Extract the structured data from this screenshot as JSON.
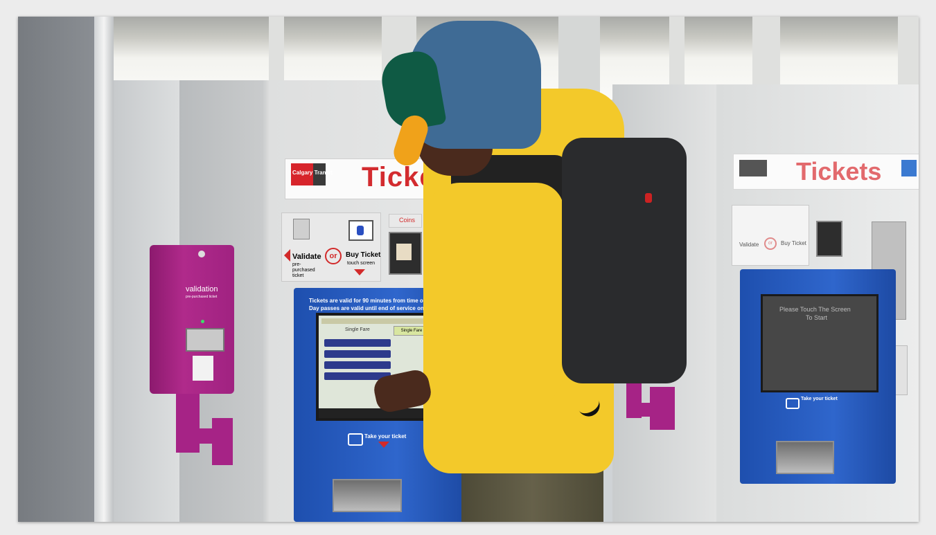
{
  "scene": {
    "left_kiosk": {
      "header": "Tickets",
      "logo": "Calgary Transit",
      "validate_label": "Validate",
      "validate_sub": "pre-purchased ticket",
      "or_label": "or",
      "buy_label": "Buy Ticket",
      "buy_sub": "touch screen",
      "coins_label": "Coins",
      "notice_line1": "Tickets are valid for 90 minutes from time of purchase.",
      "notice_line2": "Day passes are valid until end of service on the day of purchase.",
      "screen_title": "Single Fare",
      "screen_button": "Single Fare",
      "take_ticket": "Take your ticket"
    },
    "validator": {
      "label": "validation",
      "sub": "pre-purchased ticket"
    },
    "right_kiosk": {
      "header": "Tickets",
      "validate_label": "Validate",
      "or_label": "or",
      "buy_label": "Buy Ticket",
      "screen_text_line1": "Please Touch The Screen",
      "screen_text_line2": "To Start",
      "take_ticket": "Take your ticket"
    }
  },
  "colors": {
    "brand_red": "#d32b2f",
    "kiosk_blue": "#2f66cc",
    "validator_magenta": "#b02a8b",
    "jacket_yellow": "#f3c92a"
  }
}
